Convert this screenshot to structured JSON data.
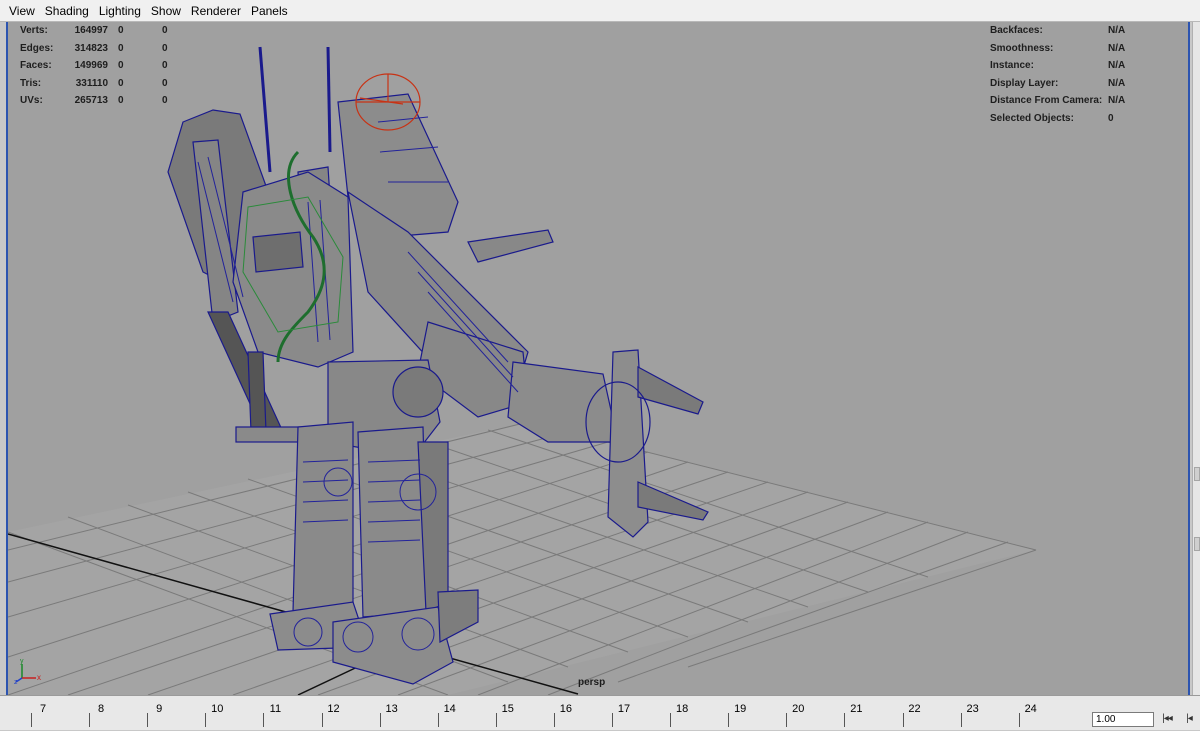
{
  "menu": [
    "View",
    "Shading",
    "Lighting",
    "Show",
    "Renderer",
    "Panels"
  ],
  "hud_left": [
    {
      "label": "Verts:",
      "v1": "164997",
      "v2": "0",
      "v3": "0"
    },
    {
      "label": "Edges:",
      "v1": "314823",
      "v2": "0",
      "v3": "0"
    },
    {
      "label": "Faces:",
      "v1": "149969",
      "v2": "0",
      "v3": "0"
    },
    {
      "label": "Tris:",
      "v1": "331110",
      "v2": "0",
      "v3": "0"
    },
    {
      "label": "UVs:",
      "v1": "265713",
      "v2": "0",
      "v3": "0"
    }
  ],
  "hud_right": [
    {
      "label": "Backfaces:",
      "value": "N/A"
    },
    {
      "label": "Smoothness:",
      "value": "N/A"
    },
    {
      "label": "Instance:",
      "value": "N/A"
    },
    {
      "label": "Display Layer:",
      "value": "N/A"
    },
    {
      "label": "Distance From Camera:",
      "value": "N/A"
    },
    {
      "label": "Selected Objects:",
      "value": "0"
    }
  ],
  "camera_label": "persp",
  "axis": {
    "y": "y",
    "x": "x",
    "z": "z"
  },
  "timeline": {
    "ticks": [
      "7",
      "8",
      "9",
      "10",
      "11",
      "12",
      "13",
      "14",
      "15",
      "16",
      "17",
      "18",
      "19",
      "20",
      "21",
      "22",
      "23",
      "24"
    ],
    "current_frame": "1.00",
    "buttons": {
      "step_back_key": "|◂◂",
      "go_start": "|◂"
    }
  },
  "colors": {
    "viewport_bg": "#a0a0a0",
    "wireframe": "#1a1a8c",
    "selection_green": "#1e6e2e",
    "rig_red": "#c83214",
    "hud_text": "#1e1e1e"
  }
}
